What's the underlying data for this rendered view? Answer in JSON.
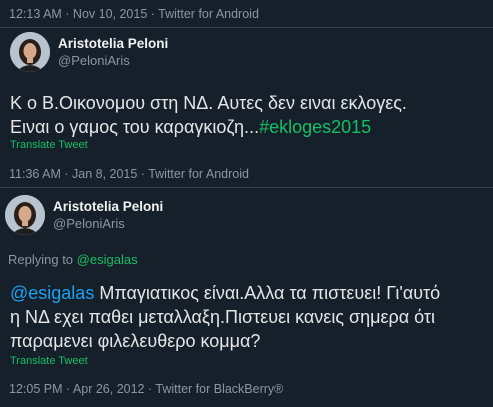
{
  "top_meta": "12:13 AM · Nov 10, 2015 · Twitter for Android",
  "tweet1": {
    "author": {
      "display_name": "Aristotelia Peloni",
      "handle": "@PeloniAris"
    },
    "text_line1": "Κ ο Β.Οικονομου στη ΝΔ. Αυτες δεν ειναι εκλογες.",
    "text_line2_prefix": "Ειναι ο γαμος του καραγκιοζη...",
    "hashtag": "#ekloges2015",
    "translate_label": "Translate Tweet",
    "meta": "11:36 AM · Jan 8, 2015 · Twitter for Android"
  },
  "tweet2": {
    "author": {
      "display_name": "Aristotelia Peloni",
      "handle": "@PeloniAris"
    },
    "replying_prefix": "Replying to",
    "replying_to": "@esigalas",
    "mention": "@esigalas",
    "text_after_mention": " Μπαγιατικος είναι.Αλλα τα πιστευει! Γι'αυτό",
    "text_line2": "η ΝΔ εχει παθει μεταλλαξη.Πιστευει κανεις σημερα ότι",
    "text_line3": "παραμενει φιλελευθερο κομμα?",
    "translate_label": "Translate Tweet",
    "meta": "12:05 PM · Apr 26, 2012 · Twitter for BlackBerry®"
  }
}
